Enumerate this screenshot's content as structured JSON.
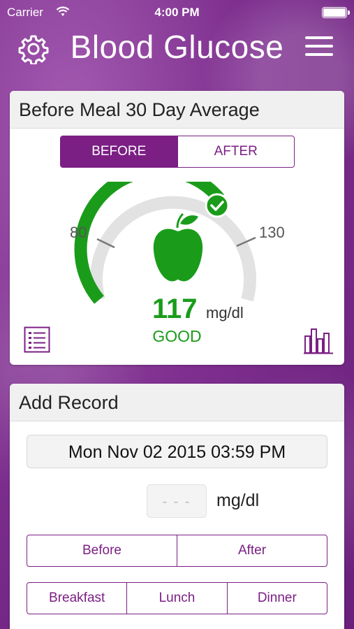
{
  "status_bar": {
    "carrier": "Carrier",
    "time": "4:00 PM"
  },
  "nav": {
    "title": "Blood Glucose"
  },
  "average_card": {
    "title": "Before Meal 30 Day Average",
    "toggle": [
      "BEFORE",
      "AFTER"
    ],
    "selected_toggle": "BEFORE",
    "gauge": {
      "low_label": "80",
      "high_label": "130",
      "value": "117",
      "unit": "mg/dl",
      "status": "GOOD",
      "status_color": "#1a9c1a"
    }
  },
  "add_record": {
    "title": "Add Record",
    "datetime": "Mon Nov 02 2015  03:59 PM",
    "glucose_placeholder": "- - -",
    "glucose_unit": "mg/dl",
    "timing_options": [
      "Before",
      "After"
    ],
    "meal_options": [
      "Breakfast",
      "Lunch",
      "Dinner"
    ]
  },
  "colors": {
    "accent": "#7b1f84",
    "good": "#1a9c1a"
  }
}
